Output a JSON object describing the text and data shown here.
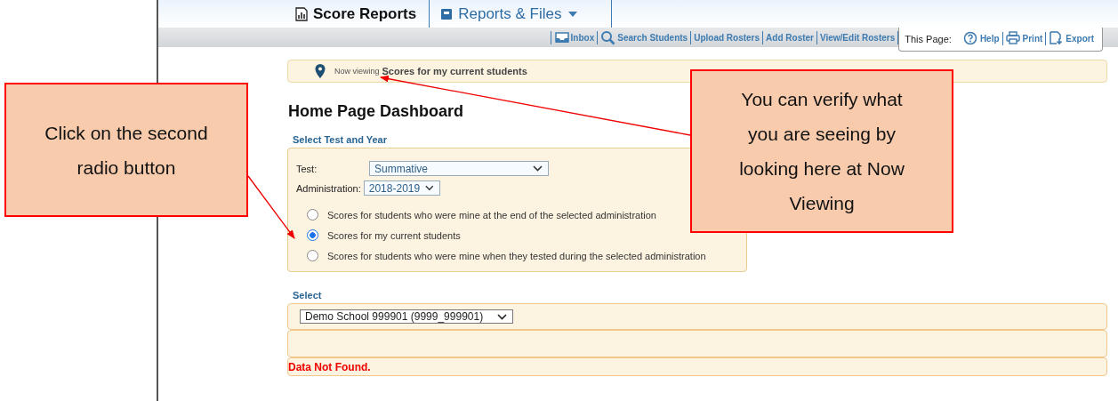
{
  "tabs": [
    {
      "label": "Score Reports",
      "selected": true,
      "has_menu": false
    },
    {
      "label": "Reports & Files",
      "selected": false,
      "has_menu": true
    }
  ],
  "toolbar": {
    "links": [
      {
        "label": "Inbox",
        "kind": "inbox"
      },
      {
        "label": "Search Students",
        "kind": "search"
      },
      {
        "label": "Upload Rosters",
        "kind": "plain"
      },
      {
        "label": "Add Roster",
        "kind": "plain"
      },
      {
        "label": "View/Edit Rosters",
        "kind": "plain"
      }
    ],
    "this_page": {
      "label": "This Page:",
      "links": [
        {
          "label": "Help",
          "kind": "help"
        },
        {
          "label": "Print",
          "kind": "print"
        },
        {
          "label": "Export",
          "kind": "export"
        }
      ]
    }
  },
  "now_viewing": {
    "label": "Now viewing",
    "value": "Scores for my current students"
  },
  "heading": "Home Page Dashboard",
  "test_year": {
    "title": "Select Test and Year",
    "test": {
      "label": "Test:",
      "value": "Summative"
    },
    "administration": {
      "label": "Administration:",
      "value": "2018-2019"
    },
    "options": [
      {
        "label": "Scores for students who were mine at the end of the selected administration",
        "selected": false
      },
      {
        "label": "Scores for my current students",
        "selected": true
      },
      {
        "label": "Scores for students who were mine when they tested during the selected administration",
        "selected": false
      }
    ]
  },
  "select_section": {
    "title": "Select",
    "school": "Demo School 999901 (9999_999901)",
    "message": "Data Not Found."
  },
  "callouts": [
    {
      "text": "Click on the second radio button"
    },
    {
      "text": "You can verify what you are seeing by looking here at Now Viewing"
    }
  ]
}
